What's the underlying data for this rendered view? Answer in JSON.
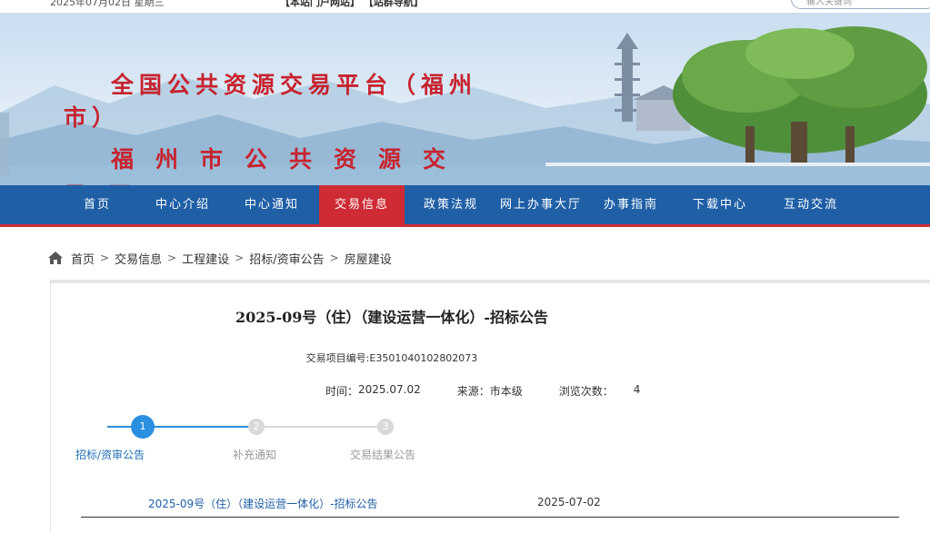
{
  "topbar": {
    "date": "2025年07月02日 星期三",
    "links": "【本站门户网站】 【站群导航】",
    "search_placeholder": "输入关键词"
  },
  "banner": {
    "title_line1": "全国公共资源交易平台（福州市）",
    "title_line2": "福州市公共资源交易网"
  },
  "nav": {
    "items": [
      {
        "label": "首页"
      },
      {
        "label": "中心介绍"
      },
      {
        "label": "中心通知"
      },
      {
        "label": "交易信息"
      },
      {
        "label": "政策法规"
      },
      {
        "label": "网上办事大厅"
      },
      {
        "label": "办事指南"
      },
      {
        "label": "下载中心"
      },
      {
        "label": "互动交流"
      }
    ],
    "active_index": 3
  },
  "breadcrumb": {
    "items": [
      "首页",
      "交易信息",
      "工程建设",
      "招标/资审公告",
      "房屋建设"
    ],
    "separator": ">"
  },
  "article": {
    "title": "2025-09号（住）（建设运营一体化）-招标公告",
    "project_no": "交易项目编号:E3501040102802073",
    "time_label": "时间：",
    "time_value": "2025.07.02",
    "source_label": "来源：",
    "source_value": "市本级",
    "views_label": "浏览次数：",
    "views_value": "4"
  },
  "steps": [
    {
      "num": "1",
      "label": "招标/资审公告",
      "active": true
    },
    {
      "num": "2",
      "label": "补充通知",
      "active": false
    },
    {
      "num": "3",
      "label": "交易结果公告",
      "active": false
    }
  ],
  "list": [
    {
      "name": "2025-09号（住）（建设运营一体化）-招标公告",
      "date": "2025-07-02"
    }
  ],
  "colors": {
    "nav_bg": "#1f5fa6",
    "nav_active": "#cf2b35",
    "title_red": "#c7232f",
    "step_active": "#2b8fe0",
    "step_inactive": "#d9d9d9"
  }
}
